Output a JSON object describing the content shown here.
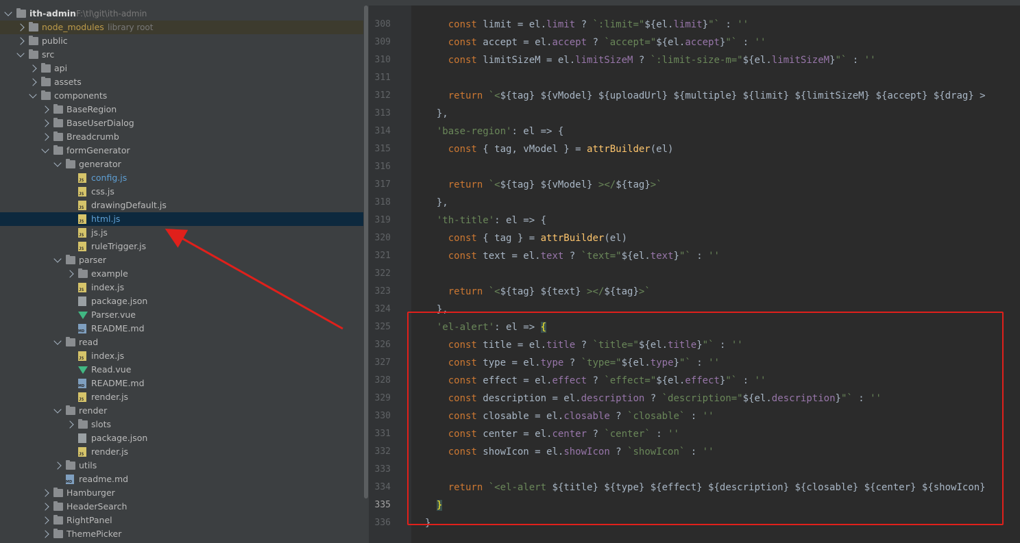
{
  "project": {
    "name": "ith-admin",
    "path": "F:\\tl\\git\\ith-admin"
  },
  "tree": [
    {
      "label": "node_modules",
      "hint": "library root",
      "kind": "folder",
      "depth": 1,
      "arrow": "right",
      "style": "lib"
    },
    {
      "label": "public",
      "kind": "folder",
      "depth": 1,
      "arrow": "right"
    },
    {
      "label": "src",
      "kind": "folder",
      "depth": 1,
      "arrow": "down"
    },
    {
      "label": "api",
      "kind": "folder",
      "depth": 2,
      "arrow": "right"
    },
    {
      "label": "assets",
      "kind": "folder",
      "depth": 2,
      "arrow": "right"
    },
    {
      "label": "components",
      "kind": "folder",
      "depth": 2,
      "arrow": "down"
    },
    {
      "label": "BaseRegion",
      "kind": "folder",
      "depth": 3,
      "arrow": "right"
    },
    {
      "label": "BaseUserDialog",
      "kind": "folder",
      "depth": 3,
      "arrow": "right"
    },
    {
      "label": "Breadcrumb",
      "kind": "folder",
      "depth": 3,
      "arrow": "right"
    },
    {
      "label": "formGenerator",
      "kind": "folder",
      "depth": 3,
      "arrow": "down"
    },
    {
      "label": "generator",
      "kind": "folder",
      "depth": 4,
      "arrow": "down"
    },
    {
      "label": "config.js",
      "kind": "js",
      "depth": 5,
      "style": "highlight"
    },
    {
      "label": "css.js",
      "kind": "js",
      "depth": 5
    },
    {
      "label": "drawingDefault.js",
      "kind": "js",
      "depth": 5
    },
    {
      "label": "html.js",
      "kind": "js",
      "depth": 5,
      "style": "highlight",
      "selected": true
    },
    {
      "label": "js.js",
      "kind": "js",
      "depth": 5
    },
    {
      "label": "ruleTrigger.js",
      "kind": "js",
      "depth": 5
    },
    {
      "label": "parser",
      "kind": "folder",
      "depth": 4,
      "arrow": "down"
    },
    {
      "label": "example",
      "kind": "folder",
      "depth": 5,
      "arrow": "right"
    },
    {
      "label": "index.js",
      "kind": "js",
      "depth": 5
    },
    {
      "label": "package.json",
      "kind": "json",
      "depth": 5
    },
    {
      "label": "Parser.vue",
      "kind": "vue",
      "depth": 5
    },
    {
      "label": "README.md",
      "kind": "md",
      "depth": 5
    },
    {
      "label": "read",
      "kind": "folder",
      "depth": 4,
      "arrow": "down"
    },
    {
      "label": "index.js",
      "kind": "js",
      "depth": 5
    },
    {
      "label": "Read.vue",
      "kind": "vue",
      "depth": 5
    },
    {
      "label": "README.md",
      "kind": "md",
      "depth": 5
    },
    {
      "label": "render.js",
      "kind": "js",
      "depth": 5
    },
    {
      "label": "render",
      "kind": "folder",
      "depth": 4,
      "arrow": "down"
    },
    {
      "label": "slots",
      "kind": "folder",
      "depth": 5,
      "arrow": "right"
    },
    {
      "label": "package.json",
      "kind": "json",
      "depth": 5
    },
    {
      "label": "render.js",
      "kind": "js",
      "depth": 5
    },
    {
      "label": "utils",
      "kind": "folder",
      "depth": 4,
      "arrow": "right"
    },
    {
      "label": "readme.md",
      "kind": "md",
      "depth": 4
    },
    {
      "label": "Hamburger",
      "kind": "folder",
      "depth": 3,
      "arrow": "right"
    },
    {
      "label": "HeaderSearch",
      "kind": "folder",
      "depth": 3,
      "arrow": "right"
    },
    {
      "label": "RightPanel",
      "kind": "folder",
      "depth": 3,
      "arrow": "right"
    },
    {
      "label": "ThemePicker",
      "kind": "folder",
      "depth": 3,
      "arrow": "right"
    }
  ],
  "editor": {
    "current_line": 335,
    "lines": [
      {
        "n": "308",
        "tokens": [
          [
            "    ",
            "p"
          ],
          [
            "const ",
            "k"
          ],
          [
            "limit = el.",
            "p"
          ],
          [
            "limit",
            "v"
          ],
          [
            " ? ",
            "p"
          ],
          [
            "`:limit=\"",
            "s"
          ],
          [
            "${",
            "p"
          ],
          [
            "el.",
            "p"
          ],
          [
            "limit",
            "v"
          ],
          [
            "}",
            "p"
          ],
          [
            "\"`",
            "s"
          ],
          [
            " : ",
            "p"
          ],
          [
            "''",
            "s"
          ]
        ]
      },
      {
        "n": "309",
        "tokens": [
          [
            "    ",
            "p"
          ],
          [
            "const ",
            "k"
          ],
          [
            "accept = el.",
            "p"
          ],
          [
            "accept",
            "v"
          ],
          [
            " ? ",
            "p"
          ],
          [
            "`accept=\"",
            "s"
          ],
          [
            "${",
            "p"
          ],
          [
            "el.",
            "p"
          ],
          [
            "accept",
            "v"
          ],
          [
            "}",
            "p"
          ],
          [
            "\"`",
            "s"
          ],
          [
            " : ",
            "p"
          ],
          [
            "''",
            "s"
          ]
        ]
      },
      {
        "n": "310",
        "tokens": [
          [
            "    ",
            "p"
          ],
          [
            "const ",
            "k"
          ],
          [
            "limitSizeM = el.",
            "p"
          ],
          [
            "limitSizeM",
            "v"
          ],
          [
            " ? ",
            "p"
          ],
          [
            "`:limit-size-m=\"",
            "s"
          ],
          [
            "${",
            "p"
          ],
          [
            "el.",
            "p"
          ],
          [
            "limitSizeM",
            "v"
          ],
          [
            "}",
            "p"
          ],
          [
            "\"`",
            "s"
          ],
          [
            " : ",
            "p"
          ],
          [
            "''",
            "s"
          ]
        ]
      },
      {
        "n": "311",
        "tokens": []
      },
      {
        "n": "312",
        "tokens": [
          [
            "    ",
            "p"
          ],
          [
            "return ",
            "k"
          ],
          [
            "`<",
            "s"
          ],
          [
            "${tag} ${vModel} ${uploadUrl} ${multiple} ${limit} ${limitSizeM} ${accept} ${drag} >",
            "p"
          ]
        ]
      },
      {
        "n": "313",
        "tokens": [
          [
            "  },",
            "p"
          ]
        ]
      },
      {
        "n": "314",
        "tokens": [
          [
            "  ",
            "p"
          ],
          [
            "'base-region'",
            "s"
          ],
          [
            ": el => {",
            "p"
          ]
        ]
      },
      {
        "n": "315",
        "tokens": [
          [
            "    ",
            "p"
          ],
          [
            "const ",
            "k"
          ],
          [
            "{ tag, vModel } = ",
            "p"
          ],
          [
            "attrBuilder",
            "f"
          ],
          [
            "(el)",
            "p"
          ]
        ]
      },
      {
        "n": "316",
        "tokens": []
      },
      {
        "n": "317",
        "tokens": [
          [
            "    ",
            "p"
          ],
          [
            "return ",
            "k"
          ],
          [
            "`<",
            "s"
          ],
          [
            "${tag} ${vModel} ",
            "p"
          ],
          [
            "></",
            "s"
          ],
          [
            "${tag}",
            "p"
          ],
          [
            ">`",
            "s"
          ]
        ]
      },
      {
        "n": "318",
        "tokens": [
          [
            "  },",
            "p"
          ]
        ]
      },
      {
        "n": "319",
        "tokens": [
          [
            "  ",
            "p"
          ],
          [
            "'th-title'",
            "s"
          ],
          [
            ": el => {",
            "p"
          ]
        ]
      },
      {
        "n": "320",
        "tokens": [
          [
            "    ",
            "p"
          ],
          [
            "const ",
            "k"
          ],
          [
            "{ tag } = ",
            "p"
          ],
          [
            "attrBuilder",
            "f"
          ],
          [
            "(el)",
            "p"
          ]
        ]
      },
      {
        "n": "321",
        "tokens": [
          [
            "    ",
            "p"
          ],
          [
            "const ",
            "k"
          ],
          [
            "text = el.",
            "p"
          ],
          [
            "text",
            "v"
          ],
          [
            " ? ",
            "p"
          ],
          [
            "`text=\"",
            "s"
          ],
          [
            "${",
            "p"
          ],
          [
            "el.",
            "p"
          ],
          [
            "text",
            "v"
          ],
          [
            "}",
            "p"
          ],
          [
            "\"`",
            "s"
          ],
          [
            " : ",
            "p"
          ],
          [
            "''",
            "s"
          ]
        ]
      },
      {
        "n": "322",
        "tokens": []
      },
      {
        "n": "323",
        "tokens": [
          [
            "    ",
            "p"
          ],
          [
            "return ",
            "k"
          ],
          [
            "`<",
            "s"
          ],
          [
            "${tag} ${text} ",
            "p"
          ],
          [
            "></",
            "s"
          ],
          [
            "${tag}",
            "p"
          ],
          [
            ">`",
            "s"
          ]
        ]
      },
      {
        "n": "324",
        "tokens": [
          [
            "  },",
            "p"
          ]
        ]
      },
      {
        "n": "325",
        "tokens": [
          [
            "  ",
            "p"
          ],
          [
            "'el-alert'",
            "s"
          ],
          [
            ": el => ",
            "p"
          ],
          [
            "{",
            "b"
          ]
        ]
      },
      {
        "n": "326",
        "tokens": [
          [
            "    ",
            "p"
          ],
          [
            "const ",
            "k"
          ],
          [
            "title = el.",
            "p"
          ],
          [
            "title",
            "v"
          ],
          [
            " ? ",
            "p"
          ],
          [
            "`title=\"",
            "s"
          ],
          [
            "${",
            "p"
          ],
          [
            "el.",
            "p"
          ],
          [
            "title",
            "v"
          ],
          [
            "}",
            "p"
          ],
          [
            "\"`",
            "s"
          ],
          [
            " : ",
            "p"
          ],
          [
            "''",
            "s"
          ]
        ]
      },
      {
        "n": "327",
        "tokens": [
          [
            "    ",
            "p"
          ],
          [
            "const ",
            "k"
          ],
          [
            "type = el.",
            "p"
          ],
          [
            "type",
            "v"
          ],
          [
            " ? ",
            "p"
          ],
          [
            "`type=\"",
            "s"
          ],
          [
            "${",
            "p"
          ],
          [
            "el.",
            "p"
          ],
          [
            "type",
            "v"
          ],
          [
            "}",
            "p"
          ],
          [
            "\"`",
            "s"
          ],
          [
            " : ",
            "p"
          ],
          [
            "''",
            "s"
          ]
        ]
      },
      {
        "n": "328",
        "tokens": [
          [
            "    ",
            "p"
          ],
          [
            "const ",
            "k"
          ],
          [
            "effect = el.",
            "p"
          ],
          [
            "effect",
            "v"
          ],
          [
            " ? ",
            "p"
          ],
          [
            "`effect=\"",
            "s"
          ],
          [
            "${",
            "p"
          ],
          [
            "el.",
            "p"
          ],
          [
            "effect",
            "v"
          ],
          [
            "}",
            "p"
          ],
          [
            "\"`",
            "s"
          ],
          [
            " : ",
            "p"
          ],
          [
            "''",
            "s"
          ]
        ]
      },
      {
        "n": "329",
        "tokens": [
          [
            "    ",
            "p"
          ],
          [
            "const ",
            "k"
          ],
          [
            "description = el.",
            "p"
          ],
          [
            "description",
            "v"
          ],
          [
            " ? ",
            "p"
          ],
          [
            "`description=\"",
            "s"
          ],
          [
            "${",
            "p"
          ],
          [
            "el.",
            "p"
          ],
          [
            "description",
            "v"
          ],
          [
            "}",
            "p"
          ],
          [
            "\"`",
            "s"
          ],
          [
            " : ",
            "p"
          ],
          [
            "''",
            "s"
          ]
        ]
      },
      {
        "n": "330",
        "tokens": [
          [
            "    ",
            "p"
          ],
          [
            "const ",
            "k"
          ],
          [
            "closable = el.",
            "p"
          ],
          [
            "closable",
            "v"
          ],
          [
            " ? ",
            "p"
          ],
          [
            "`closable`",
            "s"
          ],
          [
            " : ",
            "p"
          ],
          [
            "''",
            "s"
          ]
        ]
      },
      {
        "n": "331",
        "tokens": [
          [
            "    ",
            "p"
          ],
          [
            "const ",
            "k"
          ],
          [
            "center = el.",
            "p"
          ],
          [
            "center",
            "v"
          ],
          [
            " ? ",
            "p"
          ],
          [
            "`center`",
            "s"
          ],
          [
            " : ",
            "p"
          ],
          [
            "''",
            "s"
          ]
        ]
      },
      {
        "n": "332",
        "tokens": [
          [
            "    ",
            "p"
          ],
          [
            "const ",
            "k"
          ],
          [
            "showIcon = el.",
            "p"
          ],
          [
            "showIcon",
            "v"
          ],
          [
            " ? ",
            "p"
          ],
          [
            "`showIcon`",
            "s"
          ],
          [
            " : ",
            "p"
          ],
          [
            "''",
            "s"
          ]
        ]
      },
      {
        "n": "333",
        "tokens": []
      },
      {
        "n": "334",
        "tokens": [
          [
            "    ",
            "p"
          ],
          [
            "return ",
            "k"
          ],
          [
            "`<el-alert ",
            "s"
          ],
          [
            "${title} ${type} ${effect} ${description} ${closable} ${center} ${showIcon}",
            "p"
          ]
        ]
      },
      {
        "n": "335",
        "tokens": [
          [
            "  ",
            "p"
          ],
          [
            "}",
            "b"
          ]
        ]
      },
      {
        "n": "336",
        "tokens": [
          [
            "}",
            "p"
          ]
        ]
      }
    ]
  },
  "colors": {
    "annotation_red": "#e0201b"
  }
}
